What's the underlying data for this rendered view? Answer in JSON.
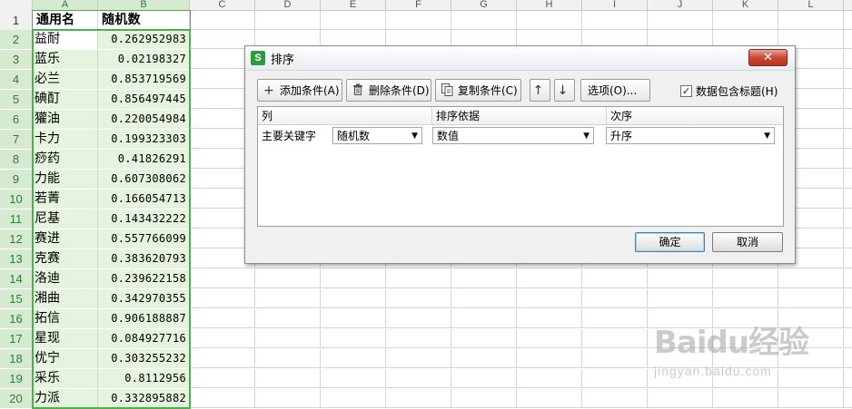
{
  "sheet": {
    "columns": [
      "A",
      "B",
      "C",
      "D",
      "E",
      "F",
      "G",
      "H",
      "I",
      "J",
      "K",
      "L"
    ],
    "header_row": {
      "row": "1",
      "a": "通用名",
      "b": "随机数"
    },
    "rows": [
      {
        "row": "2",
        "a": "益耐",
        "b": "0.262952983"
      },
      {
        "row": "3",
        "a": "蓝乐",
        "b": "0.02198327"
      },
      {
        "row": "4",
        "a": "必兰",
        "b": "0.853719569"
      },
      {
        "row": "5",
        "a": "碘酊",
        "b": "0.856497445"
      },
      {
        "row": "6",
        "a": "獾油",
        "b": "0.220054984"
      },
      {
        "row": "7",
        "a": "卡力",
        "b": "0.199323303"
      },
      {
        "row": "8",
        "a": "痧药",
        "b": "0.41826291"
      },
      {
        "row": "9",
        "a": "力能",
        "b": "0.607308062"
      },
      {
        "row": "10",
        "a": "若菁",
        "b": "0.166054713"
      },
      {
        "row": "11",
        "a": "尼基",
        "b": "0.143432222"
      },
      {
        "row": "12",
        "a": "赛进",
        "b": "0.557766099"
      },
      {
        "row": "13",
        "a": "克赛",
        "b": "0.383620793"
      },
      {
        "row": "14",
        "a": "洛迪",
        "b": "0.239622158"
      },
      {
        "row": "15",
        "a": "湘曲",
        "b": "0.342970355"
      },
      {
        "row": "16",
        "a": "拓信",
        "b": "0.906188887"
      },
      {
        "row": "17",
        "a": "星现",
        "b": "0.084927716"
      },
      {
        "row": "18",
        "a": "优宁",
        "b": "0.303255232"
      },
      {
        "row": "19",
        "a": "采乐",
        "b": "0.8112956"
      },
      {
        "row": "20",
        "a": "力派",
        "b": "0.332895882"
      }
    ]
  },
  "dialog": {
    "icon_letter": "S",
    "title": "排序",
    "close_glyph": "✕",
    "toolbar": {
      "add_label": "添加条件(A)",
      "delete_label": "删除条件(D)",
      "copy_label": "复制条件(C)",
      "up_glyph": "↑",
      "down_glyph": "↓",
      "options_label": "选项(O)...",
      "header_checkbox_label": "数据包含标题(H)",
      "header_checkbox_checked": "✓"
    },
    "grid": {
      "col_column": "列",
      "col_basis": "排序依据",
      "col_order": "次序",
      "row_key_label": "主要关键字",
      "column_value": "随机数",
      "basis_value": "数值",
      "order_value": "升序"
    },
    "ok_label": "确定",
    "cancel_label": "取消"
  },
  "watermark": {
    "logo": "Baidu经验",
    "url": "jingyan.baidu.com"
  },
  "colors": {
    "selection_green": "#4caf50",
    "close_red": "#c94a34"
  }
}
